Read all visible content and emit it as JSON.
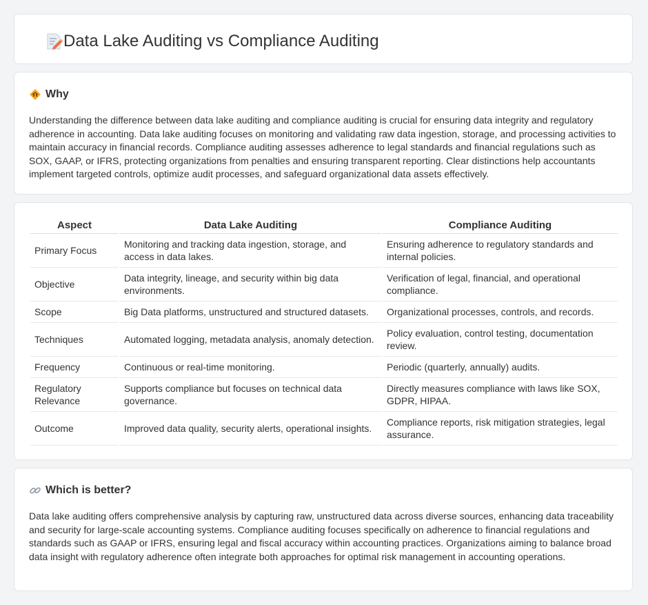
{
  "header": {
    "title": "Data Lake Auditing vs Compliance Auditing",
    "icon": "document-pencil-icon"
  },
  "why": {
    "heading": "Why",
    "icon": "diamond-warning-icon",
    "text": "Understanding the difference between data lake auditing and compliance auditing is crucial for ensuring data integrity and regulatory adherence in accounting. Data lake auditing focuses on monitoring and validating raw data ingestion, storage, and processing activities to maintain accuracy in financial records. Compliance auditing assesses adherence to legal standards and financial regulations such as SOX, GAAP, or IFRS, protecting organizations from penalties and ensuring transparent reporting. Clear distinctions help accountants implement targeted controls, optimize audit processes, and safeguard organizational data assets effectively."
  },
  "table": {
    "headers": [
      "Aspect",
      "Data Lake Auditing",
      "Compliance Auditing"
    ],
    "rows": [
      [
        "Primary Focus",
        "Monitoring and tracking data ingestion, storage, and access in data lakes.",
        "Ensuring adherence to regulatory standards and internal policies."
      ],
      [
        "Objective",
        "Data integrity, lineage, and security within big data environments.",
        "Verification of legal, financial, and operational compliance."
      ],
      [
        "Scope",
        "Big Data platforms, unstructured and structured datasets.",
        "Organizational processes, controls, and records."
      ],
      [
        "Techniques",
        "Automated logging, metadata analysis, anomaly detection.",
        "Policy evaluation, control testing, documentation review."
      ],
      [
        "Frequency",
        "Continuous or real-time monitoring.",
        "Periodic (quarterly, annually) audits."
      ],
      [
        "Regulatory Relevance",
        "Supports compliance but focuses on technical data governance.",
        "Directly measures compliance with laws like SOX, GDPR, HIPAA."
      ],
      [
        "Outcome",
        "Improved data quality, security alerts, operational insights.",
        "Compliance reports, risk mitigation strategies, legal assurance."
      ]
    ]
  },
  "better": {
    "heading": "Which is better?",
    "icon": "link-icon",
    "text": "Data lake auditing offers comprehensive analysis by capturing raw, unstructured data across diverse sources, enhancing data traceability and security for large-scale accounting systems. Compliance auditing focuses specifically on adherence to financial regulations and standards such as GAAP or IFRS, ensuring legal and fiscal accuracy within accounting practices. Organizations aiming to balance broad data insight with regulatory adherence often integrate both approaches for optimal risk management in accounting operations."
  }
}
